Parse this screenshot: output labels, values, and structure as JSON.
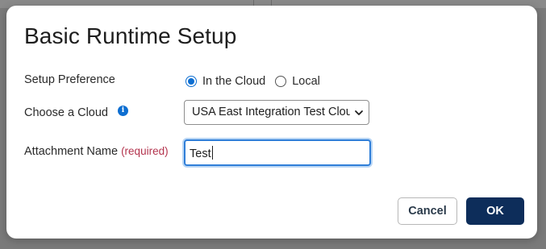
{
  "dialog": {
    "title": "Basic Runtime Setup",
    "setup_preference": {
      "label": "Setup Preference",
      "options": [
        {
          "label": "In the Cloud",
          "selected": true
        },
        {
          "label": "Local",
          "selected": false
        }
      ]
    },
    "choose_cloud": {
      "label": "Choose a Cloud",
      "info_icon": "info-icon",
      "selected_value": "USA East Integration Test Cloud"
    },
    "attachment_name": {
      "label": "Attachment Name",
      "required_label": "(required)",
      "value": "Test"
    },
    "buttons": {
      "cancel": "Cancel",
      "ok": "OK"
    }
  },
  "colors": {
    "accent": "#0d6ed1",
    "primary_button": "#0d2d5a",
    "required_text": "#b3334d",
    "focus_border": "#2f7ed8"
  }
}
